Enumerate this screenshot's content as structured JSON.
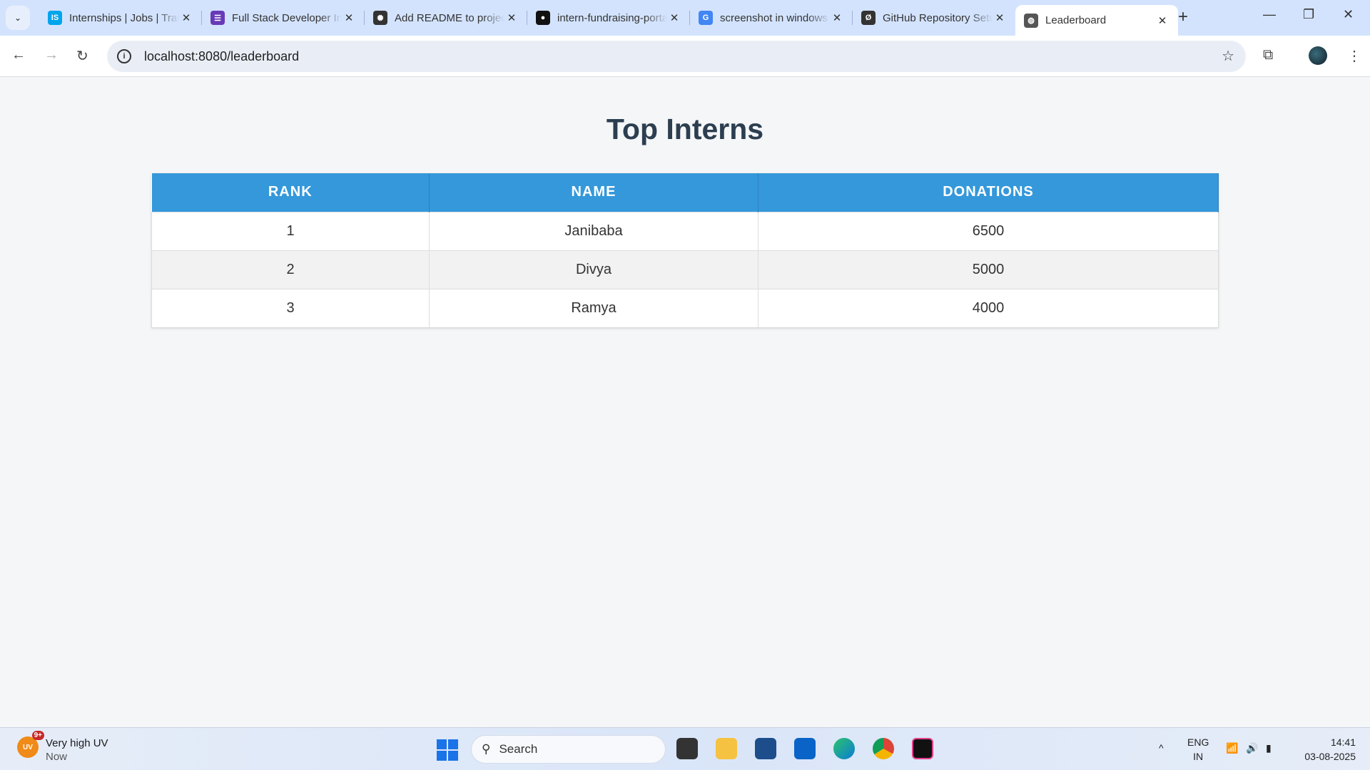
{
  "browser": {
    "tabs": [
      {
        "title": "Internships | Jobs | Training",
        "favicon": "internshala-icon",
        "color": "#00a5ec",
        "glyph": "IS"
      },
      {
        "title": "Full Stack Developer Intern",
        "favicon": "forms-icon",
        "color": "#673ab7",
        "glyph": "☰"
      },
      {
        "title": "Add README to project",
        "favicon": "chatgpt-icon",
        "color": "#333333",
        "glyph": "✺"
      },
      {
        "title": "intern-fundraising-portal",
        "favicon": "github-icon",
        "color": "#111111",
        "glyph": "●"
      },
      {
        "title": "screenshot in windows",
        "favicon": "google-icon",
        "color": "#4285f4",
        "glyph": "G"
      },
      {
        "title": "GitHub Repository Setup",
        "favicon": "slash-icon",
        "color": "#333333",
        "glyph": "Ø"
      },
      {
        "title": "Leaderboard",
        "favicon": "globe-icon",
        "color": "#555555",
        "glyph": "◍",
        "active": true
      }
    ],
    "url": "localhost:8080/leaderboard"
  },
  "page": {
    "title": "Top Interns",
    "table": {
      "headers": [
        "RANK",
        "NAME",
        "DONATIONS"
      ],
      "rows": [
        [
          "1",
          "Janibaba",
          "6500"
        ],
        [
          "2",
          "Divya",
          "5000"
        ],
        [
          "3",
          "Ramya",
          "4000"
        ]
      ]
    }
  },
  "taskbar": {
    "weather": {
      "badge": "9+",
      "icon_text": "UV",
      "title": "Very high UV",
      "subtitle": "Now"
    },
    "search_placeholder": "Search",
    "lang": "ENG",
    "region": "IN",
    "time": "14:41",
    "date": "03-08-2025"
  }
}
